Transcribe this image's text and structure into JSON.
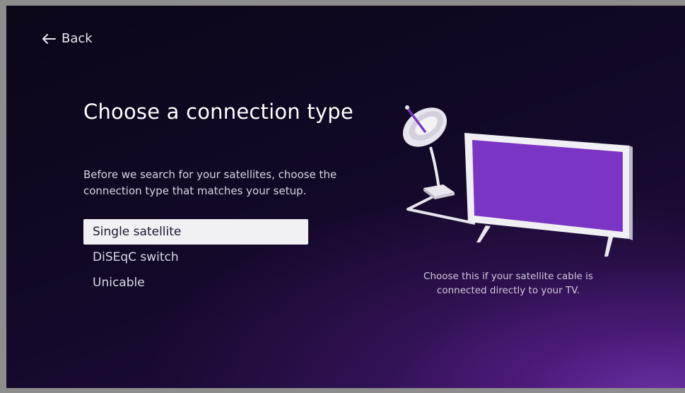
{
  "nav": {
    "back_label": "Back"
  },
  "main": {
    "title": "Choose a connection type",
    "description": "Before we search for your satellites, choose the connection type that matches your setup.",
    "options": [
      {
        "label": "Single satellite",
        "selected": true
      },
      {
        "label": "DiSEqC switch",
        "selected": false
      },
      {
        "label": "Unicable",
        "selected": false
      }
    ]
  },
  "preview": {
    "hint": "Choose this if your satellite cable is connected directly to your TV.",
    "illustration": "satellite-dish-connected-to-tv",
    "screen_color": "#7b35c4"
  },
  "theme": {
    "background": "#120826",
    "accent": "#6f2dbd",
    "selected_bg": "#f1f0f3"
  }
}
